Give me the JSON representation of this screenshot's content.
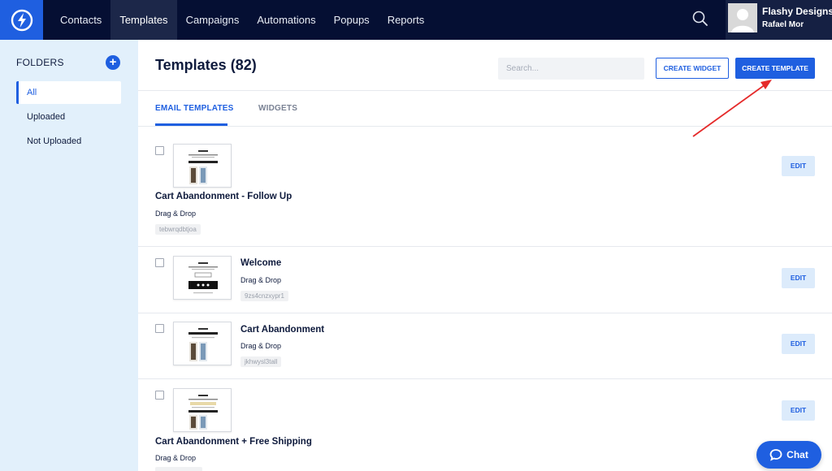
{
  "nav": {
    "items": [
      "Contacts",
      "Templates",
      "Campaigns",
      "Automations",
      "Popups",
      "Reports"
    ],
    "active_index": 1
  },
  "user": {
    "company": "Flashy Designs",
    "name": "Rafael Mor"
  },
  "sidebar": {
    "title": "FOLDERS",
    "folders": [
      "All",
      "Uploaded",
      "Not Uploaded"
    ],
    "active_index": 0
  },
  "header": {
    "title": "Templates (82)",
    "search_placeholder": "Search...",
    "create_widget_label": "CREATE WIDGET",
    "create_template_label": "CREATE TEMPLATE"
  },
  "tabs": {
    "items": [
      "EMAIL TEMPLATES",
      "WIDGETS"
    ],
    "active_index": 0
  },
  "templates": [
    {
      "title": "Cart Abandonment - Follow Up",
      "type": "Drag & Drop",
      "code": "tebwrqdbtjoa",
      "edit_label": "EDIT"
    },
    {
      "title": "Welcome",
      "type": "Drag & Drop",
      "code": "9zs4cnzxypr1",
      "edit_label": "EDIT"
    },
    {
      "title": "Cart Abandonment",
      "type": "Drag & Drop",
      "code": "jkhwysl3tall",
      "edit_label": "EDIT"
    },
    {
      "title": "Cart Abandonment + Free Shipping",
      "type": "Drag & Drop",
      "code": "",
      "edit_label": "EDIT"
    }
  ],
  "chat": {
    "label": "Chat"
  },
  "colors": {
    "topbar": "#050f33",
    "accent": "#1f5fe0",
    "sidebar_bg": "#e2f0fb",
    "annotation_arrow": "#e52a2a"
  }
}
